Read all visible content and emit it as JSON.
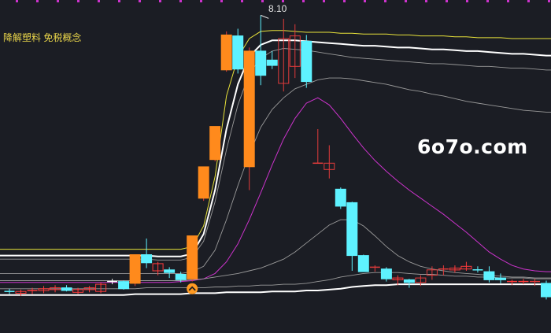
{
  "chart_data": {
    "type": "candlestick",
    "title": "降解塑料 免税概念",
    "watermark": "6o7o.com",
    "high_annotation": "8.10",
    "price_range": [
      4.6,
      8.2
    ],
    "colors": {
      "background": "#1b1d24",
      "title": "#e8d44a",
      "limit_up_candle": "#ff8a1c",
      "up_candle": "#ff3b3b",
      "down_candle": "#5ef2ff",
      "up_thin": "#e23b3b",
      "purple_band": "#cc33cc",
      "yellow_band": "#e8e23a",
      "white_band": "#ffffff",
      "gray_band": "#9a9a9a",
      "marker": "#ff9a22",
      "top_dots": "#cc33cc"
    },
    "candles": [
      {
        "o": 5.02,
        "h": 5.05,
        "l": 4.99,
        "c": 5.01,
        "kind": "down"
      },
      {
        "o": 5.0,
        "h": 5.04,
        "l": 4.97,
        "c": 5.02,
        "kind": "up"
      },
      {
        "o": 5.02,
        "h": 5.06,
        "l": 4.99,
        "c": 5.03,
        "kind": "up"
      },
      {
        "o": 5.03,
        "h": 5.08,
        "l": 5.0,
        "c": 5.05,
        "kind": "up"
      },
      {
        "o": 5.04,
        "h": 5.09,
        "l": 5.01,
        "c": 5.06,
        "kind": "up"
      },
      {
        "o": 5.06,
        "h": 5.09,
        "l": 5.02,
        "c": 5.03,
        "kind": "down"
      },
      {
        "o": 5.01,
        "h": 5.06,
        "l": 4.99,
        "c": 5.04,
        "kind": "up"
      },
      {
        "o": 5.04,
        "h": 5.08,
        "l": 5.01,
        "c": 5.06,
        "kind": "up"
      },
      {
        "o": 5.02,
        "h": 5.12,
        "l": 5.0,
        "c": 5.1,
        "kind": "up"
      },
      {
        "o": 5.13,
        "h": 5.16,
        "l": 5.1,
        "c": 5.13,
        "kind": "flat"
      },
      {
        "o": 5.13,
        "h": 5.14,
        "l": 5.04,
        "c": 5.05,
        "kind": "down"
      },
      {
        "o": 5.11,
        "h": 5.43,
        "l": 5.08,
        "c": 5.43,
        "kind": "limit"
      },
      {
        "o": 5.43,
        "h": 5.61,
        "l": 5.28,
        "c": 5.34,
        "kind": "down"
      },
      {
        "o": 5.25,
        "h": 5.35,
        "l": 5.2,
        "c": 5.33,
        "kind": "up"
      },
      {
        "o": 5.26,
        "h": 5.29,
        "l": 5.17,
        "c": 5.23,
        "kind": "down"
      },
      {
        "o": 5.21,
        "h": 5.24,
        "l": 5.12,
        "c": 5.15,
        "kind": "down"
      },
      {
        "o": 5.16,
        "h": 5.64,
        "l": 5.13,
        "c": 5.64,
        "kind": "limit"
      },
      {
        "o": 6.06,
        "h": 6.41,
        "l": 6.03,
        "c": 6.41,
        "kind": "limit"
      },
      {
        "o": 6.49,
        "h": 6.86,
        "l": 6.47,
        "c": 6.86,
        "kind": "limit"
      },
      {
        "o": 7.49,
        "h": 7.92,
        "l": 7.47,
        "c": 7.88,
        "kind": "limit"
      },
      {
        "o": 7.87,
        "h": 7.95,
        "l": 7.45,
        "c": 7.5,
        "kind": "down"
      },
      {
        "o": 6.41,
        "h": 7.74,
        "l": 6.15,
        "c": 7.7,
        "kind": "limit"
      },
      {
        "o": 7.7,
        "h": 8.1,
        "l": 7.32,
        "c": 7.43,
        "kind": "down"
      },
      {
        "o": 7.54,
        "h": 7.7,
        "l": 7.5,
        "c": 7.6,
        "kind": "down"
      },
      {
        "o": 7.34,
        "h": 8.06,
        "l": 7.25,
        "c": 7.84,
        "kind": "up_hollow"
      },
      {
        "o": 7.53,
        "h": 8.0,
        "l": 7.4,
        "c": 7.87,
        "kind": "up_hollow"
      },
      {
        "o": 7.81,
        "h": 7.88,
        "l": 7.29,
        "c": 7.36,
        "kind": "down"
      },
      {
        "o": 6.45,
        "h": 6.83,
        "l": 6.45,
        "c": 6.45,
        "kind": "flat_red"
      },
      {
        "o": 6.45,
        "h": 6.65,
        "l": 6.28,
        "c": 6.38,
        "kind": "up_hollow"
      },
      {
        "o": 6.16,
        "h": 6.18,
        "l": 5.94,
        "c": 5.97,
        "kind": "down"
      },
      {
        "o": 6.01,
        "h": 6.02,
        "l": 5.25,
        "c": 5.42,
        "kind": "down"
      },
      {
        "o": 5.42,
        "h": 5.43,
        "l": 5.24,
        "c": 5.24,
        "kind": "down"
      },
      {
        "o": 5.29,
        "h": 5.31,
        "l": 5.24,
        "c": 5.28,
        "kind": "flat_red"
      },
      {
        "o": 5.27,
        "h": 5.29,
        "l": 5.13,
        "c": 5.16,
        "kind": "down"
      },
      {
        "o": 5.17,
        "h": 5.2,
        "l": 5.09,
        "c": 5.15,
        "kind": "up"
      },
      {
        "o": 5.15,
        "h": 5.16,
        "l": 5.06,
        "c": 5.12,
        "kind": "down"
      },
      {
        "o": 5.12,
        "h": 5.2,
        "l": 5.08,
        "c": 5.17,
        "kind": "up_hollow"
      },
      {
        "o": 5.2,
        "h": 5.3,
        "l": 5.15,
        "c": 5.26,
        "kind": "up_hollow"
      },
      {
        "o": 5.27,
        "h": 5.31,
        "l": 5.2,
        "c": 5.27,
        "kind": "flat_red"
      },
      {
        "o": 5.26,
        "h": 5.31,
        "l": 5.23,
        "c": 5.28,
        "kind": "up"
      },
      {
        "o": 5.27,
        "h": 5.35,
        "l": 5.25,
        "c": 5.3,
        "kind": "up"
      },
      {
        "o": 5.26,
        "h": 5.3,
        "l": 5.23,
        "c": 5.25,
        "kind": "down"
      },
      {
        "o": 5.24,
        "h": 5.3,
        "l": 5.12,
        "c": 5.15,
        "kind": "down"
      },
      {
        "o": 5.17,
        "h": 5.22,
        "l": 5.11,
        "c": 5.15,
        "kind": "down"
      },
      {
        "o": 5.13,
        "h": 5.15,
        "l": 5.09,
        "c": 5.12,
        "kind": "up"
      },
      {
        "o": 5.13,
        "h": 5.16,
        "l": 5.1,
        "c": 5.13,
        "kind": "up"
      },
      {
        "o": 5.13,
        "h": 5.16,
        "l": 5.08,
        "c": 5.13,
        "kind": "flat_red"
      },
      {
        "o": 5.11,
        "h": 5.14,
        "l": 4.93,
        "c": 4.96,
        "kind": "down"
      }
    ],
    "bands": [
      {
        "color": "yellow",
        "values": [
          5.49,
          5.49,
          5.49,
          5.49,
          5.49,
          5.49,
          5.49,
          5.49,
          5.49,
          5.49,
          5.49,
          5.49,
          5.49,
          5.49,
          5.49,
          5.49,
          5.52,
          5.75,
          6.3,
          7.2,
          7.63,
          7.84,
          7.92,
          7.93,
          7.93,
          7.92,
          7.91,
          7.91,
          7.91,
          7.9,
          7.9,
          7.89,
          7.89,
          7.89,
          7.88,
          7.88,
          7.87,
          7.87,
          7.87,
          7.86,
          7.86,
          7.85,
          7.85,
          7.85,
          7.84,
          7.84,
          7.84,
          7.84
        ]
      },
      {
        "color": "white",
        "values": [
          5.42,
          5.42,
          5.42,
          5.42,
          5.42,
          5.42,
          5.42,
          5.42,
          5.42,
          5.42,
          5.42,
          5.42,
          5.42,
          5.41,
          5.41,
          5.41,
          5.44,
          5.66,
          6.15,
          6.83,
          7.33,
          7.64,
          7.77,
          7.82,
          7.82,
          7.82,
          7.81,
          7.8,
          7.79,
          7.78,
          7.77,
          7.76,
          7.76,
          7.75,
          7.74,
          7.74,
          7.73,
          7.72,
          7.72,
          7.71,
          7.7,
          7.7,
          7.69,
          7.68,
          7.67,
          7.67,
          7.66,
          7.65
        ]
      },
      {
        "color": "gray",
        "values": [
          5.38,
          5.38,
          5.38,
          5.38,
          5.38,
          5.38,
          5.38,
          5.38,
          5.38,
          5.38,
          5.38,
          5.38,
          5.38,
          5.37,
          5.37,
          5.37,
          5.4,
          5.58,
          6.02,
          6.6,
          7.1,
          7.45,
          7.62,
          7.7,
          7.73,
          7.72,
          7.71,
          7.69,
          7.67,
          7.65,
          7.63,
          7.62,
          7.61,
          7.6,
          7.59,
          7.58,
          7.57,
          7.56,
          7.56,
          7.55,
          7.54,
          7.53,
          7.53,
          7.52,
          7.51,
          7.51,
          7.5,
          7.49
        ]
      },
      {
        "color": "gray",
        "values": [
          5.22,
          5.22,
          5.22,
          5.22,
          5.22,
          5.22,
          5.22,
          5.22,
          5.22,
          5.22,
          5.22,
          5.22,
          5.22,
          5.22,
          5.22,
          5.22,
          5.24,
          5.3,
          5.48,
          5.82,
          6.2,
          6.55,
          6.85,
          7.05,
          7.18,
          7.28,
          7.33,
          7.38,
          7.4,
          7.4,
          7.39,
          7.37,
          7.35,
          7.33,
          7.3,
          7.27,
          7.25,
          7.22,
          7.2,
          7.17,
          7.14,
          7.12,
          7.1,
          7.08,
          7.06,
          7.04,
          7.03,
          7.02
        ]
      },
      {
        "color": "purple",
        "values": [
          5.12,
          5.12,
          5.12,
          5.12,
          5.12,
          5.12,
          5.12,
          5.12,
          5.12,
          5.12,
          5.12,
          5.12,
          5.12,
          5.12,
          5.12,
          5.13,
          5.14,
          5.16,
          5.22,
          5.35,
          5.55,
          5.82,
          6.12,
          6.43,
          6.72,
          6.95,
          7.12,
          7.18,
          7.1,
          6.95,
          6.78,
          6.62,
          6.48,
          6.36,
          6.25,
          6.15,
          6.06,
          5.97,
          5.88,
          5.78,
          5.68,
          5.57,
          5.46,
          5.38,
          5.31,
          5.27,
          5.25,
          5.24
        ]
      },
      {
        "color": "gray",
        "values": [
          5.14,
          5.14,
          5.14,
          5.14,
          5.14,
          5.14,
          5.14,
          5.14,
          5.14,
          5.14,
          5.14,
          5.14,
          5.14,
          5.14,
          5.14,
          5.14,
          5.15,
          5.16,
          5.18,
          5.2,
          5.22,
          5.25,
          5.28,
          5.33,
          5.38,
          5.46,
          5.56,
          5.66,
          5.76,
          5.82,
          5.82,
          5.75,
          5.64,
          5.52,
          5.42,
          5.35,
          5.3,
          5.27,
          5.25,
          5.23,
          5.22,
          5.21,
          5.2,
          5.19,
          5.18,
          5.18,
          5.17,
          5.17
        ]
      },
      {
        "color": "gray",
        "values": [
          5.05,
          5.05,
          5.05,
          5.05,
          5.05,
          5.05,
          5.05,
          5.05,
          5.05,
          5.05,
          5.05,
          5.05,
          5.06,
          5.06,
          5.06,
          5.06,
          5.06,
          5.06,
          5.07,
          5.07,
          5.08,
          5.08,
          5.09,
          5.09,
          5.1,
          5.1,
          5.11,
          5.13,
          5.15,
          5.18,
          5.2,
          5.22,
          5.23,
          5.23,
          5.23,
          5.22,
          5.21,
          5.21,
          5.2,
          5.19,
          5.19,
          5.18,
          5.18,
          5.17,
          5.17,
          5.17,
          5.16,
          5.16
        ]
      },
      {
        "color": "white",
        "values": [
          4.98,
          4.98,
          4.98,
          4.98,
          4.98,
          4.98,
          4.98,
          4.98,
          4.98,
          4.98,
          4.98,
          4.99,
          4.99,
          4.99,
          4.99,
          4.99,
          5.0,
          5.0,
          5.0,
          5.01,
          5.01,
          5.01,
          5.01,
          5.02,
          5.02,
          5.02,
          5.03,
          5.03,
          5.04,
          5.05,
          5.07,
          5.08,
          5.09,
          5.09,
          5.1,
          5.1,
          5.1,
          5.1,
          5.1,
          5.1,
          5.1,
          5.1,
          5.1,
          5.1,
          5.1,
          5.1,
          5.1,
          5.1
        ]
      }
    ]
  }
}
